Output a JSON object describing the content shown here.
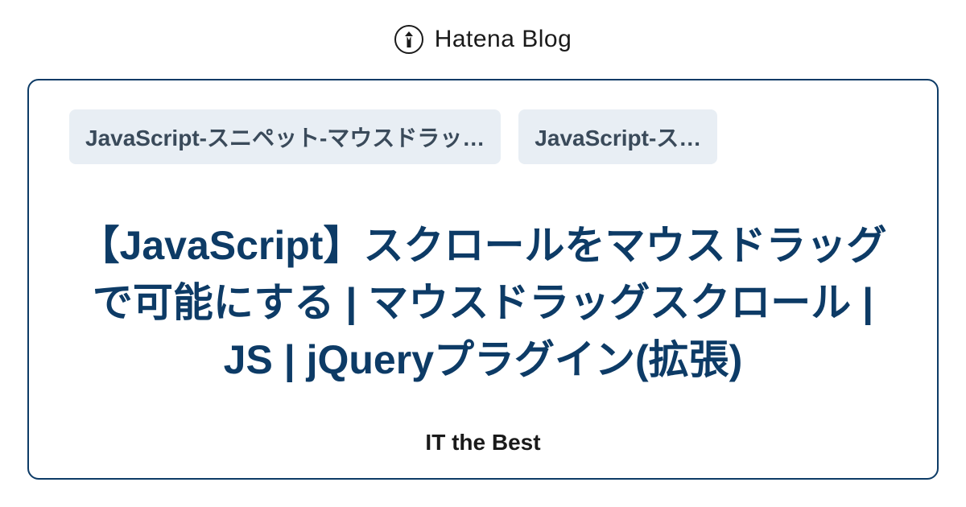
{
  "header": {
    "brand": "Hatena Blog"
  },
  "card": {
    "tags": [
      "JavaScript-スニペット-マウスドラッ…",
      "JavaScript-ス…"
    ],
    "article_title": "【JavaScript】スクロールをマウスドラッグで可能にする | マウスドラッグスクロール | JS | jQueryプラグイン(拡張)",
    "blog_name": "IT the Best"
  }
}
